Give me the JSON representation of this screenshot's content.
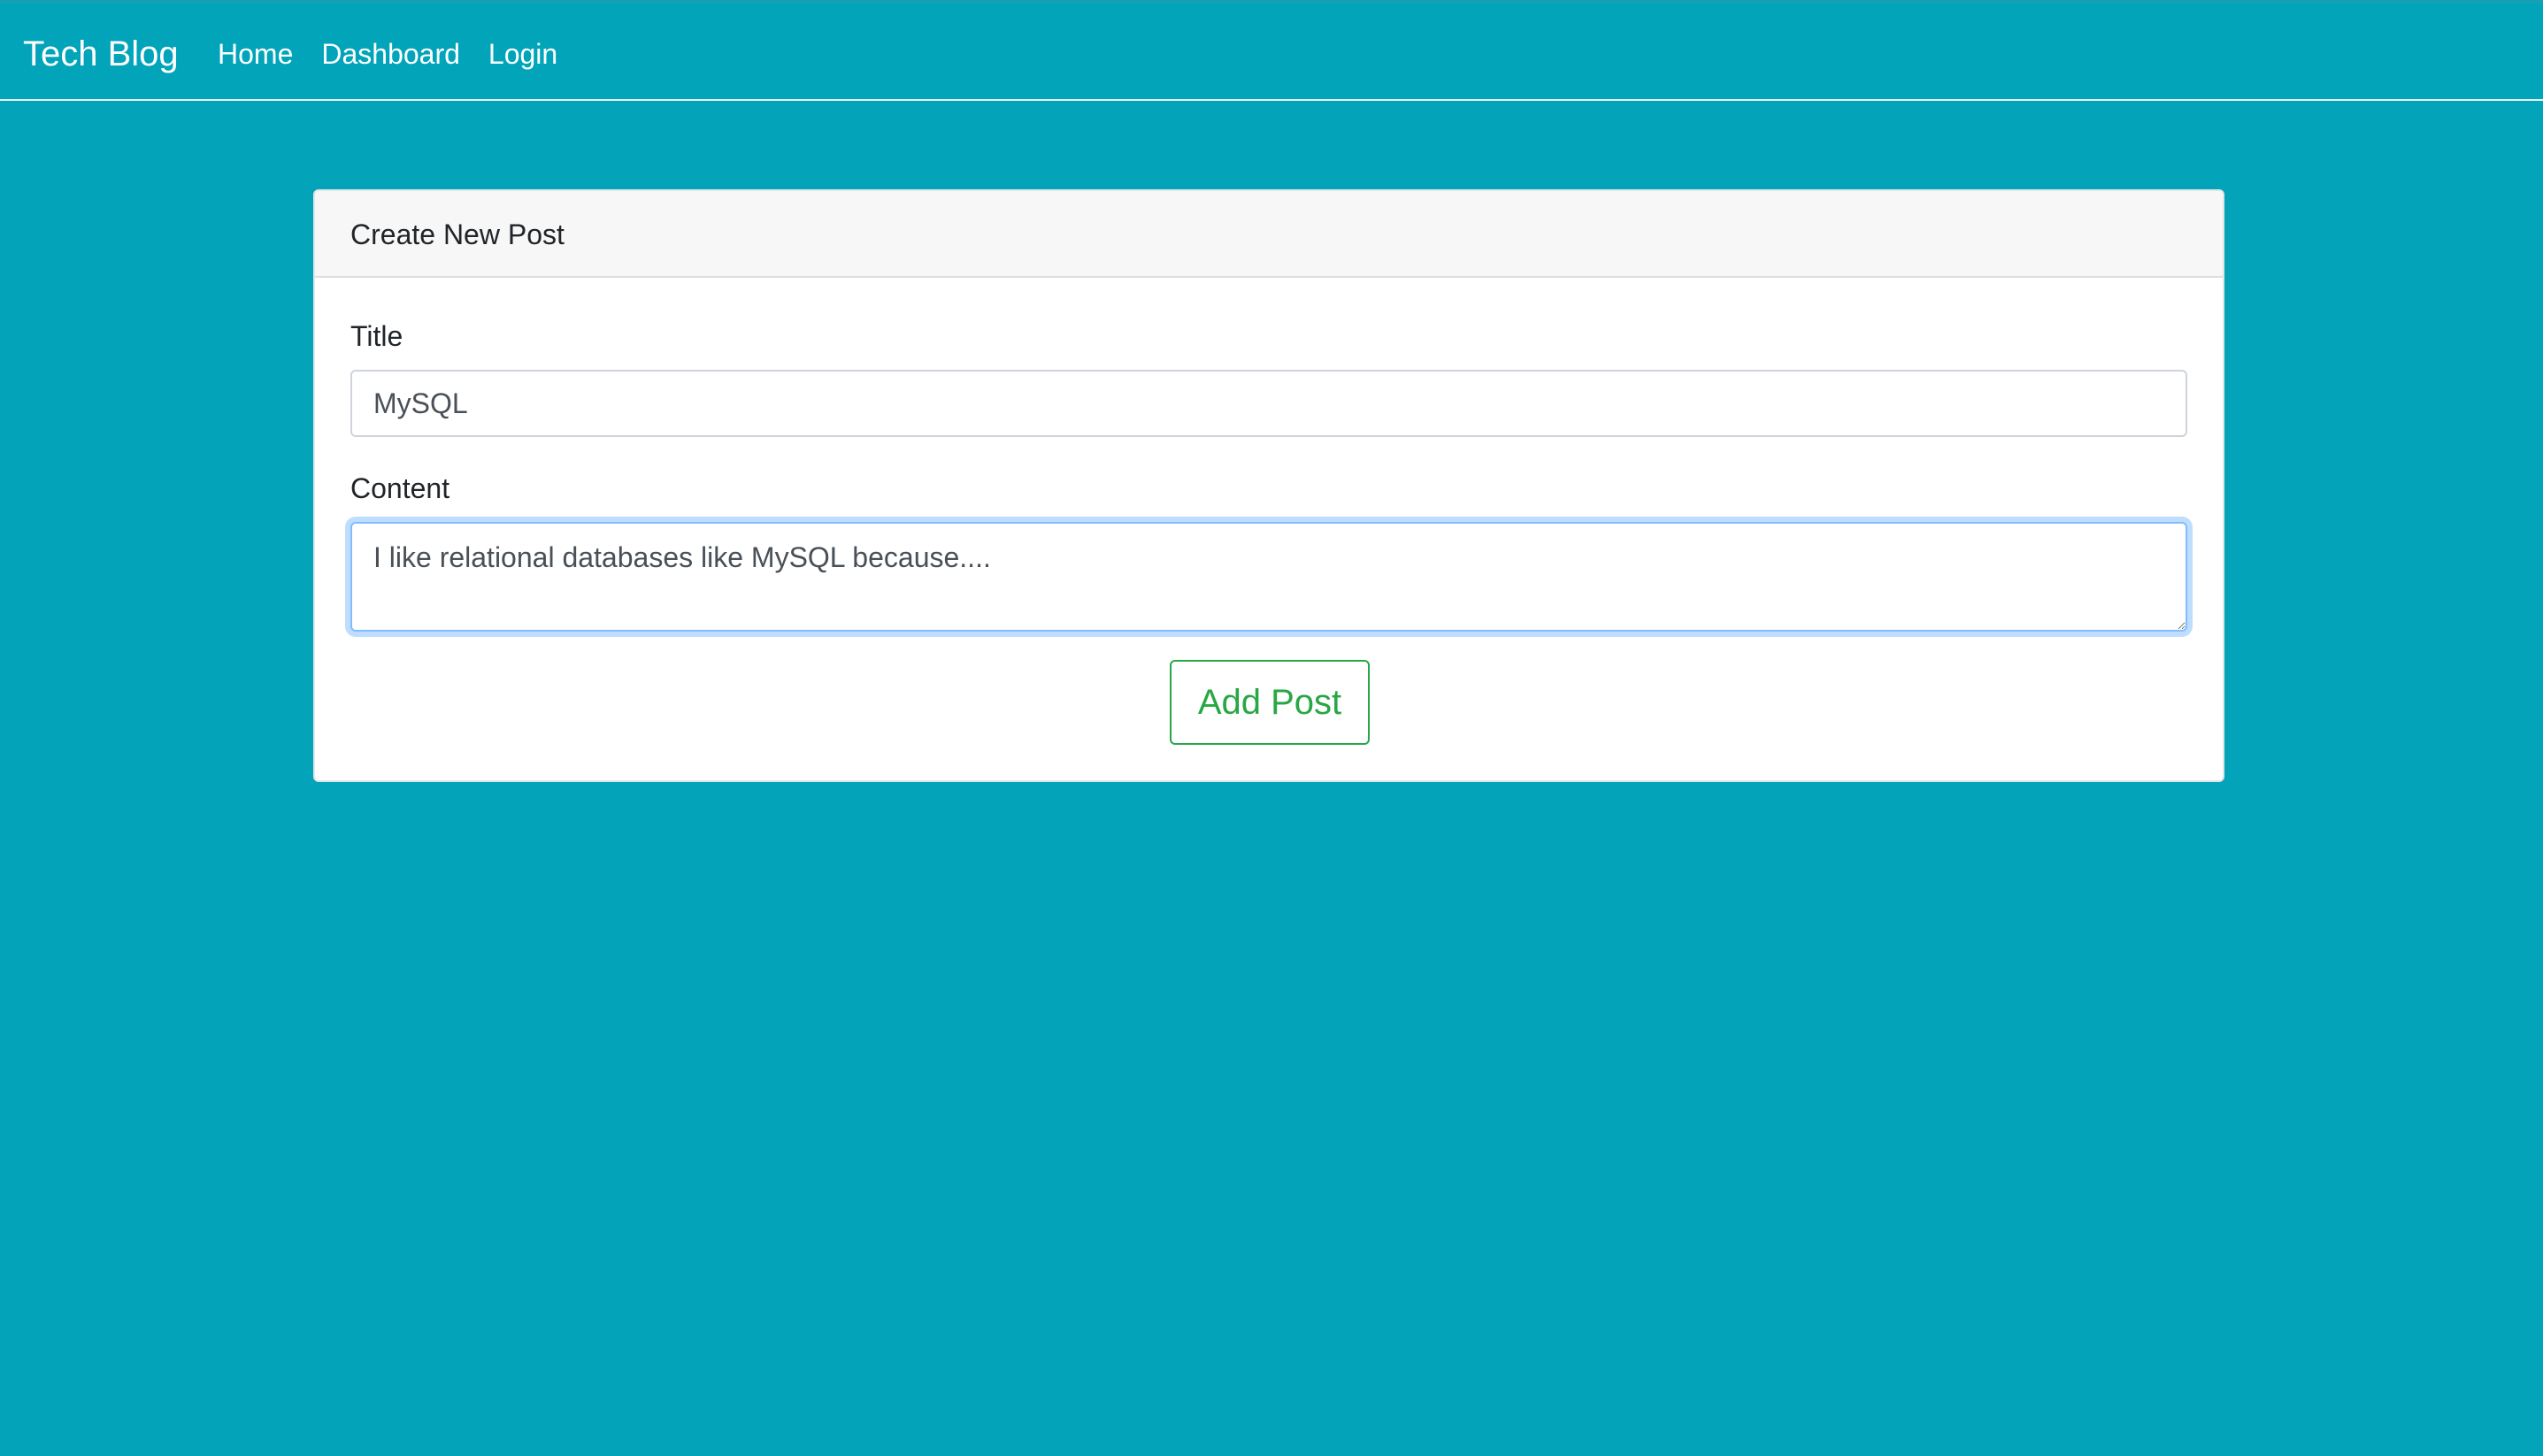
{
  "navbar": {
    "brand": "Tech Blog",
    "links": [
      {
        "label": "Home"
      },
      {
        "label": "Dashboard"
      },
      {
        "label": "Login"
      }
    ]
  },
  "form": {
    "header": "Create New Post",
    "title_label": "Title",
    "title_value": "MySQL",
    "content_label": "Content",
    "content_value": "I like relational databases like MySQL because....",
    "submit_label": "Add Post"
  },
  "colors": {
    "background": "#03A3B9",
    "accent_success": "#28A745",
    "focus_ring": "#80BDFF"
  }
}
